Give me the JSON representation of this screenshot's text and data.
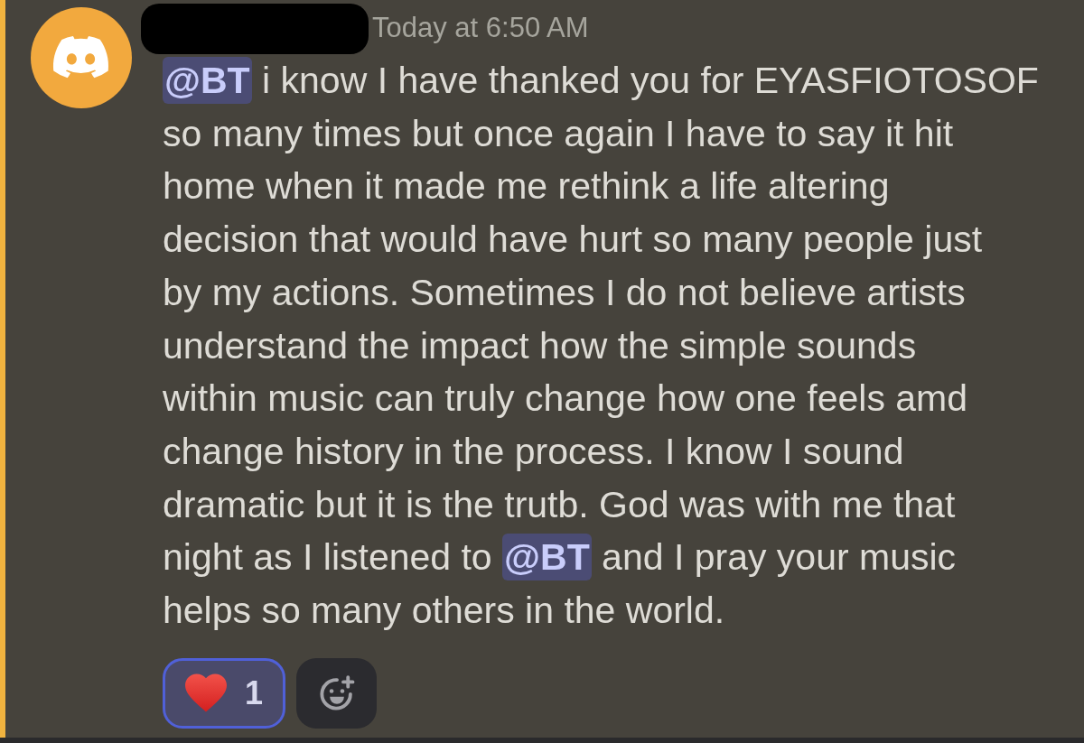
{
  "message": {
    "mentioned": true,
    "timestamp": "Today at 6:50 AM",
    "lines": [
      [
        {
          "kind": "mention",
          "text": "@BT"
        },
        {
          "kind": "text",
          "text": " i know I have thanked you for EYASFIOTOSOF"
        }
      ],
      [
        {
          "kind": "text",
          "text": "so many times but once again I have to say it hit"
        }
      ],
      [
        {
          "kind": "text",
          "text": "home when it made me rethink a life altering"
        }
      ],
      [
        {
          "kind": "text",
          "text": "decision that would have hurt so many people just"
        }
      ],
      [
        {
          "kind": "text",
          "text": "by my actions. Sometimes I do not believe artists"
        }
      ],
      [
        {
          "kind": "text",
          "text": "understand the impact how the simple sounds"
        }
      ],
      [
        {
          "kind": "text",
          "text": "within music can truly change how one feels amd"
        }
      ],
      [
        {
          "kind": "text",
          "text": "change history in the process. I know I sound"
        }
      ],
      [
        {
          "kind": "text",
          "text": "dramatic but it is the trutb. God was with me that"
        }
      ],
      [
        {
          "kind": "text",
          "text": "night as I listened to "
        },
        {
          "kind": "mention",
          "text": "@BT"
        },
        {
          "kind": "text",
          "text": " and I pray your music"
        }
      ],
      [
        {
          "kind": "text",
          "text": "helps so many others in the world."
        }
      ]
    ]
  },
  "reactions": [
    {
      "count": "1",
      "selected": true
    }
  ]
}
